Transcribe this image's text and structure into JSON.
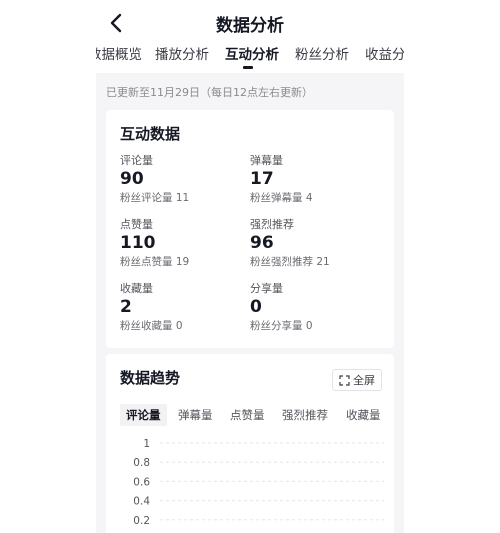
{
  "header": {
    "title": "数据分析"
  },
  "tabs": [
    {
      "label": "数据概览"
    },
    {
      "label": "播放分析"
    },
    {
      "label": "互动分析"
    },
    {
      "label": "粉丝分析"
    },
    {
      "label": "收益分析"
    }
  ],
  "active_tab": "互动分析",
  "update_note": "已更新至11月29日（每日12点左右更新）",
  "interaction": {
    "title": "互动数据",
    "metrics": [
      {
        "label": "评论量",
        "value": "90",
        "sub": "粉丝评论量 11"
      },
      {
        "label": "弹幕量",
        "value": "17",
        "sub": "粉丝弹幕量 4"
      },
      {
        "label": "点赞量",
        "value": "110",
        "sub": "粉丝点赞量 19"
      },
      {
        "label": "强烈推荐",
        "value": "96",
        "sub": "粉丝强烈推荐 21"
      },
      {
        "label": "收藏量",
        "value": "2",
        "sub": "粉丝收藏量 0"
      },
      {
        "label": "分享量",
        "value": "0",
        "sub": "粉丝分享量 0"
      }
    ]
  },
  "trend": {
    "title": "数据趋势",
    "fullscreen_label": "全屏",
    "metric_tabs": [
      "评论量",
      "弹幕量",
      "点赞量",
      "强烈推荐",
      "收藏量"
    ],
    "active_metric": "评论量"
  },
  "chart_data": {
    "type": "line",
    "title": "",
    "xlabel": "",
    "ylabel": "",
    "ylim": [
      0,
      1
    ],
    "y_ticks": [
      "1",
      "0.8",
      "0.6",
      "0.4",
      "0.2"
    ],
    "grid": true,
    "series": []
  },
  "colors": {
    "text_primary": "#161823",
    "text_secondary": "#8a8b91",
    "background": "#f5f5f7",
    "card": "#ffffff",
    "grid": "#e6e6e9"
  }
}
